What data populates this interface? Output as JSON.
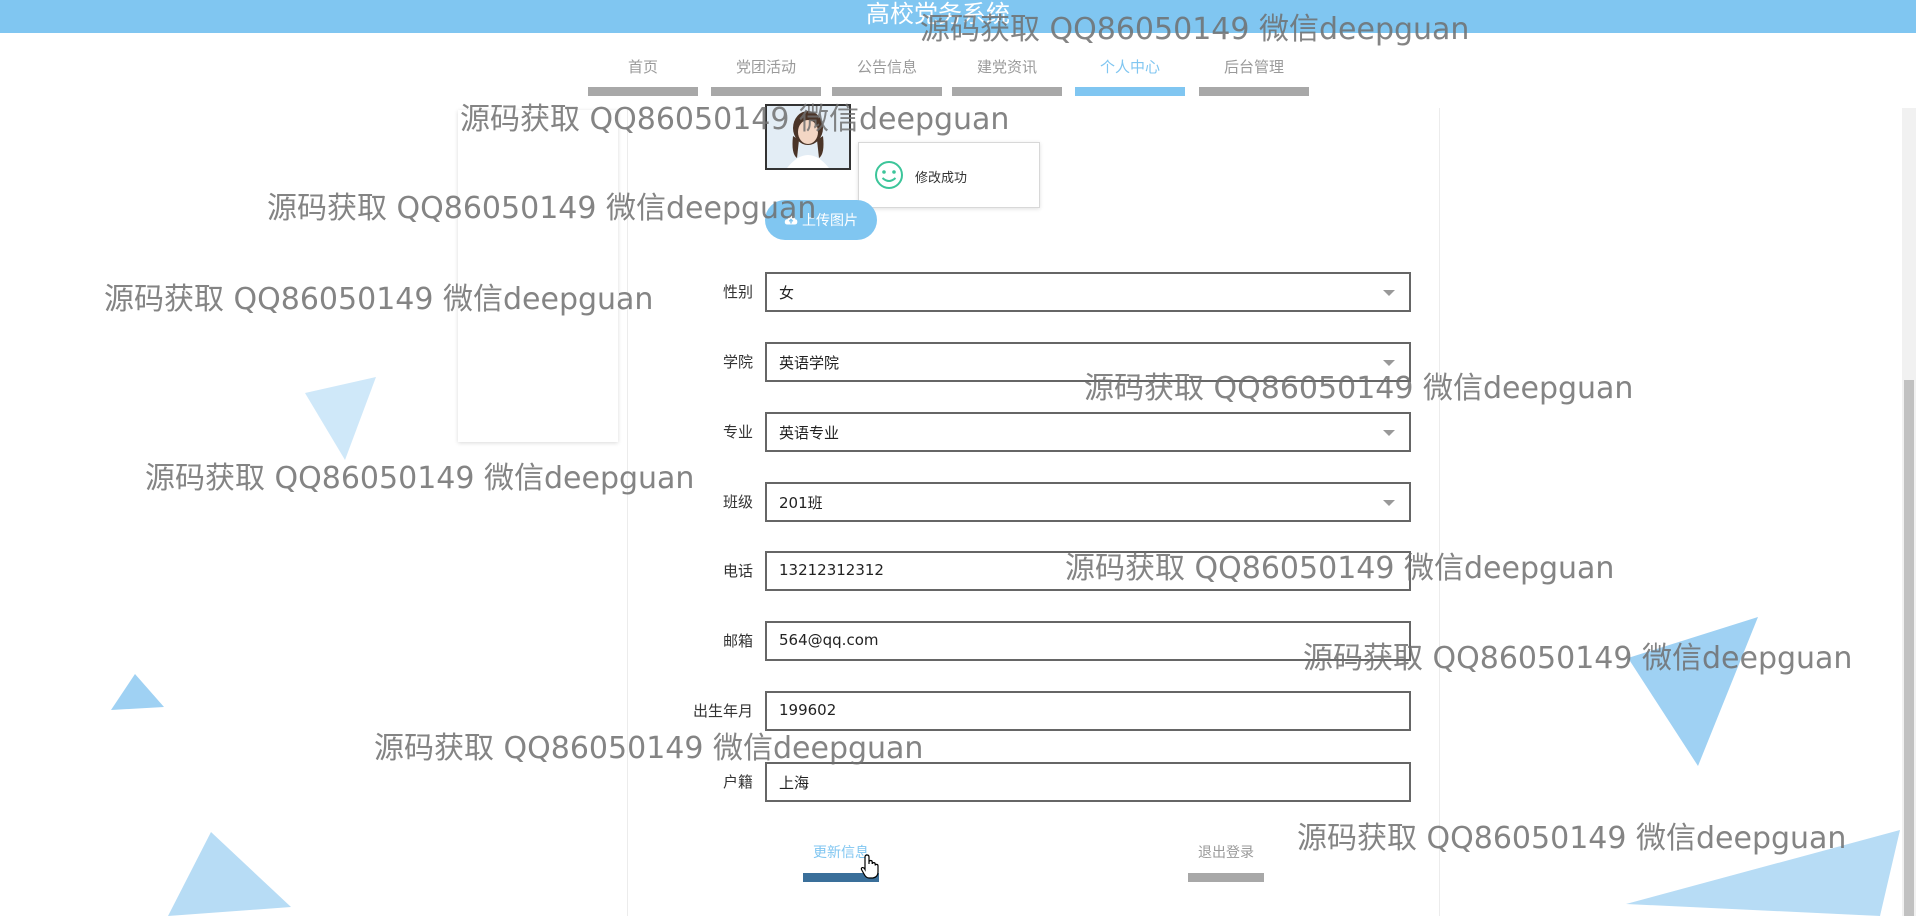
{
  "app": {
    "title": "高校党务系统"
  },
  "nav": {
    "items": [
      {
        "label": "首页",
        "active": false
      },
      {
        "label": "党团活动",
        "active": false
      },
      {
        "label": "公告信息",
        "active": false
      },
      {
        "label": "建党资讯",
        "active": false
      },
      {
        "label": "个人中心",
        "active": true
      },
      {
        "label": "后台管理",
        "active": false
      }
    ]
  },
  "profile": {
    "upload_label": "上传图片",
    "toast_message": "修改成功",
    "fields": [
      {
        "label": "性别",
        "value": "女",
        "type": "select"
      },
      {
        "label": "学院",
        "value": "英语学院",
        "type": "select"
      },
      {
        "label": "专业",
        "value": "英语专业",
        "type": "select"
      },
      {
        "label": "班级",
        "value": "201班",
        "type": "select"
      },
      {
        "label": "电话",
        "value": "13212312312",
        "type": "text"
      },
      {
        "label": "邮箱",
        "value": "564@qq.com",
        "type": "text"
      },
      {
        "label": "出生年月",
        "value": "199602",
        "type": "text"
      },
      {
        "label": "户籍",
        "value": "上海",
        "type": "text"
      }
    ],
    "update_label": "更新信息",
    "logout_label": "退出登录"
  },
  "watermark": {
    "text": "源码获取 QQ86050149 微信deepguan"
  },
  "colors": {
    "accent": "#80c6f1",
    "nav_inactive_bar": "#a8a8a8",
    "update_bar": "#3a6f9a",
    "deco": "#b7dcf5"
  },
  "icons": {
    "upload": "cloud-upload-icon",
    "toast": "smile-icon",
    "select": "chevron-down-icon"
  }
}
